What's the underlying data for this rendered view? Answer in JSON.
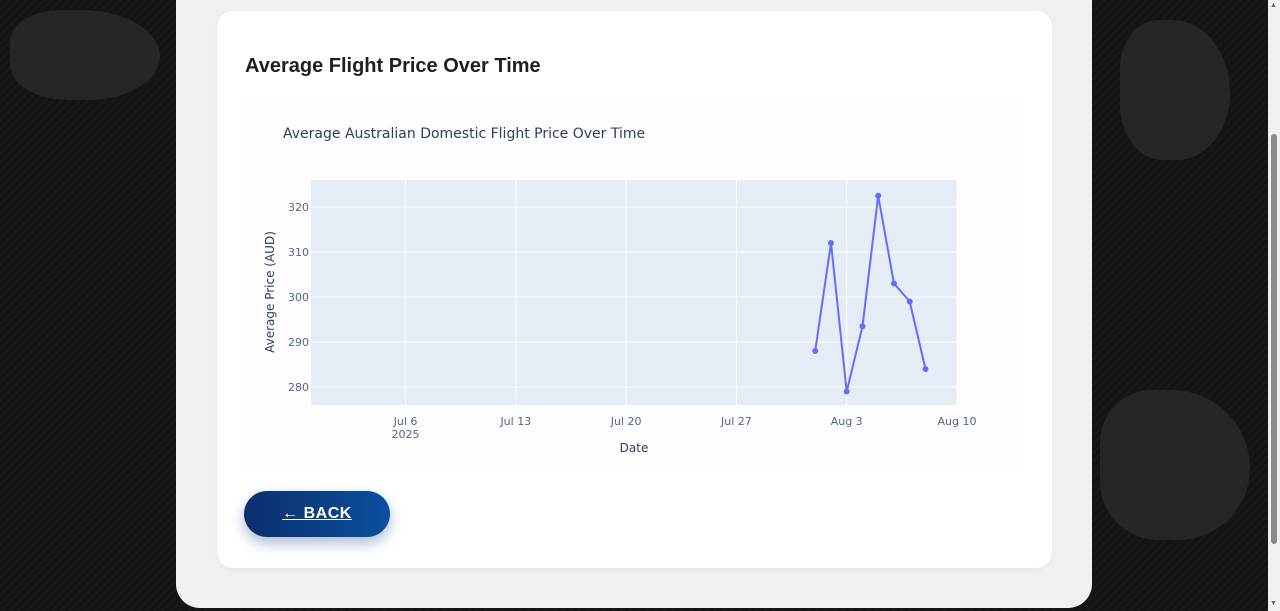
{
  "card": {
    "title": "Average Flight Price Over Time"
  },
  "back_button": {
    "label": "← BACK"
  },
  "chart_data": {
    "type": "line",
    "title": "Average Australian Domestic Flight Price Over Time",
    "xlabel": "Date",
    "ylabel": "Average Price (AUD)",
    "x_ticks": [
      {
        "date": "2025-07-06",
        "label": "Jul 6",
        "sublabel": "2025"
      },
      {
        "date": "2025-07-13",
        "label": "Jul 13",
        "sublabel": ""
      },
      {
        "date": "2025-07-20",
        "label": "Jul 20",
        "sublabel": ""
      },
      {
        "date": "2025-07-27",
        "label": "Jul 27",
        "sublabel": ""
      },
      {
        "date": "2025-08-03",
        "label": "Aug 3",
        "sublabel": ""
      },
      {
        "date": "2025-08-10",
        "label": "Aug 10",
        "sublabel": ""
      }
    ],
    "y_ticks": [
      280,
      290,
      300,
      310,
      320
    ],
    "xlim": [
      "2025-06-30",
      "2025-08-10"
    ],
    "ylim": [
      276,
      326
    ],
    "grid": true,
    "line_color": "#636efa",
    "plot_bg": "#e5ecf6",
    "series": [
      {
        "x": [
          "2025-08-01",
          "2025-08-02",
          "2025-08-03",
          "2025-08-04",
          "2025-08-05",
          "2025-08-06",
          "2025-08-07",
          "2025-08-08"
        ],
        "y": [
          288,
          312,
          279,
          293.5,
          322.5,
          303,
          299,
          284
        ]
      }
    ]
  }
}
